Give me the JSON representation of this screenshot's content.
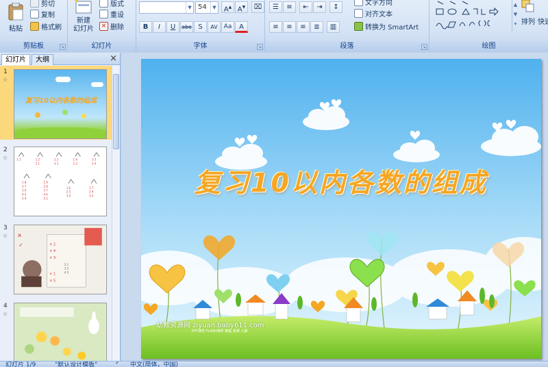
{
  "ribbon": {
    "clipboard": {
      "paste_label": "粘贴",
      "cut_label": "剪切",
      "copy_label": "复制",
      "format_painter_label": "格式刷",
      "group_label": "剪贴板"
    },
    "slides": {
      "new_slide_label": "新建\n幻灯片",
      "layout_label": "版式",
      "reset_label": "重设",
      "delete_label": "删除",
      "group_label": "幻灯片"
    },
    "font": {
      "font_name_value": "",
      "font_size_value": "54",
      "group_label": "字体",
      "buttons": [
        "B",
        "I",
        "U",
        "abe",
        "S",
        "AV",
        "Aa",
        "A"
      ]
    },
    "paragraph": {
      "text_direction_label": "文字方向",
      "align_text_label": "对齐文本",
      "smartart_label": "转换为 SmartArt",
      "group_label": "段落"
    },
    "drawing": {
      "arrange_label": "排列",
      "quick_styles_label": "快速",
      "group_label": "绘图"
    }
  },
  "left_pane": {
    "tabs": [
      "幻灯片",
      "大纲"
    ],
    "close_glyph": "×",
    "thumbnails": [
      {
        "number": "1",
        "title": "复习10以内各数的组成"
      },
      {
        "number": "2"
      },
      {
        "number": "3"
      },
      {
        "number": "4"
      }
    ]
  },
  "slide": {
    "title": "复习10以内各数的组成",
    "watermark": "幼教资源网 ziyuan.baby611.com",
    "watermark_sub": "PPT课件 FLASH课件 教案 故事 儿歌"
  },
  "status_bar": {
    "slide_count": "幻灯片 1/9",
    "theme": "\"默认设计模板\"",
    "language": "中文(简体，中国)"
  },
  "colors": {
    "ribbon_bg": "#dbe7f6",
    "accent": "#15428b",
    "selected_thumb": "#fbd87c",
    "title_orange": "#f6a623",
    "sky": "#6ec3f2",
    "grass": "#8fd13a"
  }
}
